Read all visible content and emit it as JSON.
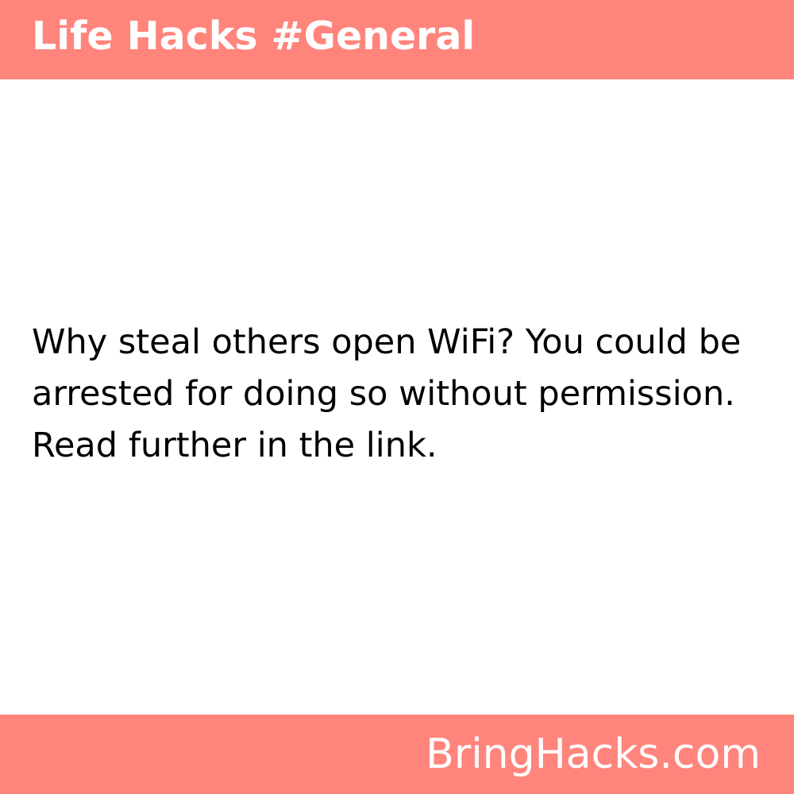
{
  "header": {
    "title": "Life Hacks #General"
  },
  "main": {
    "text": "Why steal others open WiFi? You could be arrested for doing so without permission. Read further in the link."
  },
  "footer": {
    "brand": "BringHacks.com"
  },
  "colors": {
    "banner": "#ff857c",
    "banner_text": "#ffffff",
    "background": "#ffffff",
    "body_text": "#000000"
  }
}
